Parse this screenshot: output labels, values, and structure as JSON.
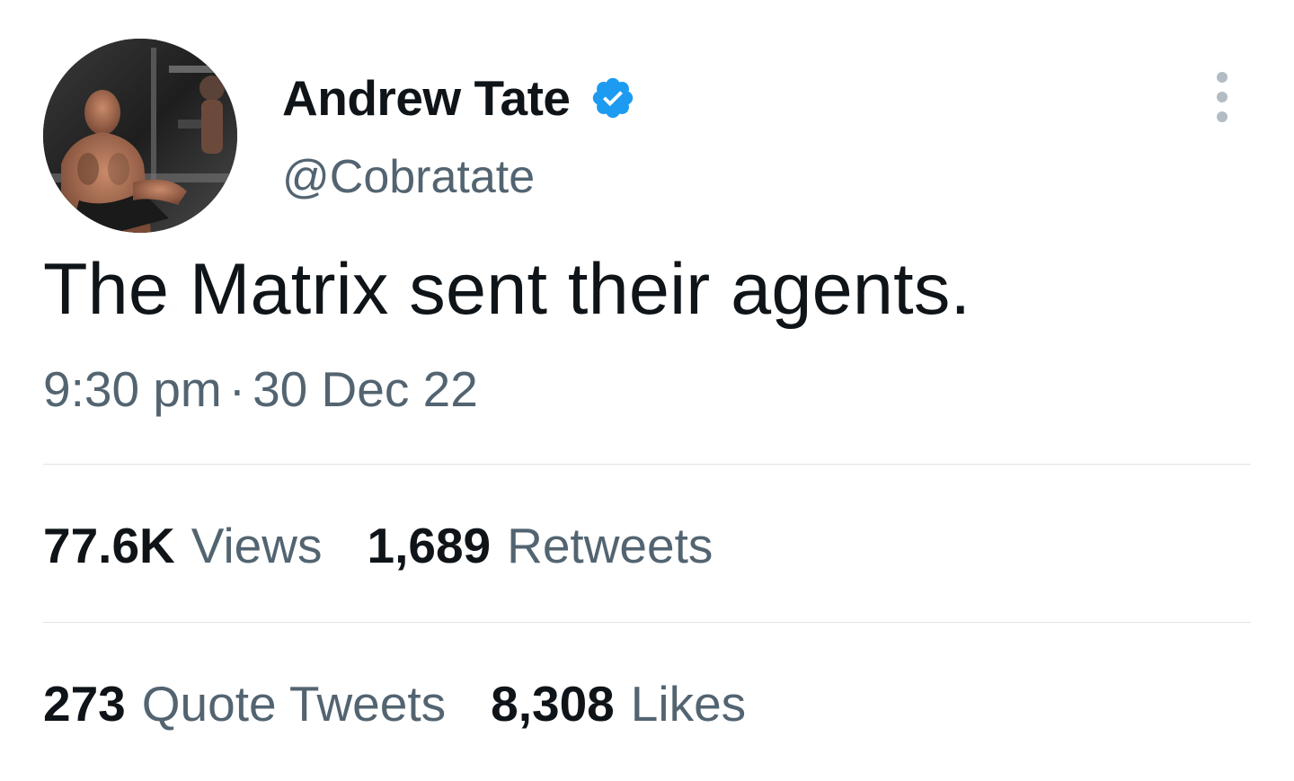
{
  "author": {
    "display_name": "Andrew Tate",
    "handle": "@Cobratate",
    "verified": true,
    "verified_color": "#1d9bf0",
    "avatar_icon": "profile-photo"
  },
  "tweet": {
    "text": "The Matrix sent their agents.",
    "time": "9:30 pm",
    "separator": "·",
    "date": "30 Dec 22"
  },
  "stats": {
    "views": {
      "value": "77.6K",
      "label": "Views"
    },
    "retweets": {
      "value": "1,689",
      "label": "Retweets"
    },
    "quote_tweets": {
      "value": "273",
      "label": "Quote Tweets"
    },
    "likes": {
      "value": "8,308",
      "label": "Likes"
    }
  },
  "colors": {
    "text_primary": "#0f1419",
    "text_secondary": "#536471",
    "divider": "#dfe3e6"
  }
}
